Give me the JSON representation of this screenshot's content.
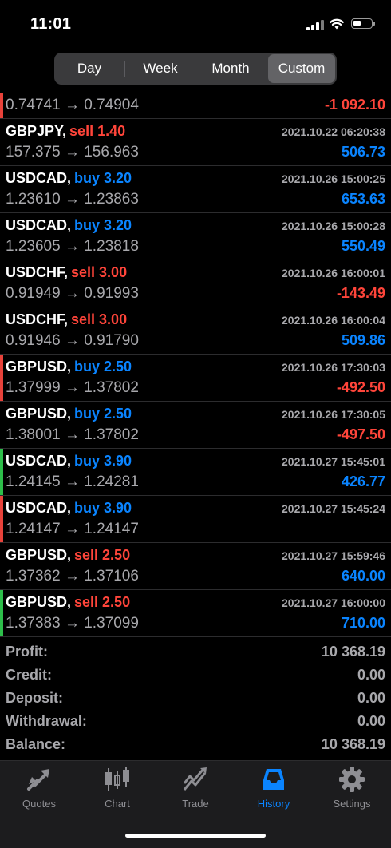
{
  "status": {
    "time": "11:01"
  },
  "periods": [
    "Day",
    "Week",
    "Month",
    "Custom"
  ],
  "active_period": "Custom",
  "first_row": {
    "prices": "0.74741 → 0.74904",
    "profit": "-1 092.10",
    "profit_sign": "neg",
    "marker": "red"
  },
  "trades": [
    {
      "symbol": "GBPJPY,",
      "side": "sell",
      "side_text": "sell 1.40",
      "time": "2021.10.22 06:20:38",
      "prices": "157.375 → 156.963",
      "profit": "506.73",
      "profit_sign": "pos",
      "marker": ""
    },
    {
      "symbol": "USDCAD,",
      "side": "buy",
      "side_text": "buy 3.20",
      "time": "2021.10.26 15:00:25",
      "prices": "1.23610 → 1.23863",
      "profit": "653.63",
      "profit_sign": "pos",
      "marker": ""
    },
    {
      "symbol": "USDCAD,",
      "side": "buy",
      "side_text": "buy 3.20",
      "time": "2021.10.26 15:00:28",
      "prices": "1.23605 → 1.23818",
      "profit": "550.49",
      "profit_sign": "pos",
      "marker": ""
    },
    {
      "symbol": "USDCHF,",
      "side": "sell",
      "side_text": "sell 3.00",
      "time": "2021.10.26 16:00:01",
      "prices": "0.91949 → 0.91993",
      "profit": "-143.49",
      "profit_sign": "neg",
      "marker": ""
    },
    {
      "symbol": "USDCHF,",
      "side": "sell",
      "side_text": "sell 3.00",
      "time": "2021.10.26 16:00:04",
      "prices": "0.91946 → 0.91790",
      "profit": "509.86",
      "profit_sign": "pos",
      "marker": ""
    },
    {
      "symbol": "GBPUSD,",
      "side": "buy",
      "side_text": "buy 2.50",
      "time": "2021.10.26 17:30:03",
      "prices": "1.37999 → 1.37802",
      "profit": "-492.50",
      "profit_sign": "neg",
      "marker": "red"
    },
    {
      "symbol": "GBPUSD,",
      "side": "buy",
      "side_text": "buy 2.50",
      "time": "2021.10.26 17:30:05",
      "prices": "1.38001 → 1.37802",
      "profit": "-497.50",
      "profit_sign": "neg",
      "marker": ""
    },
    {
      "symbol": "USDCAD,",
      "side": "buy",
      "side_text": "buy 3.90",
      "time": "2021.10.27 15:45:01",
      "prices": "1.24145 → 1.24281",
      "profit": "426.77",
      "profit_sign": "pos",
      "marker": "green"
    },
    {
      "symbol": "USDCAD,",
      "side": "buy",
      "side_text": "buy 3.90",
      "time": "2021.10.27 15:45:24",
      "prices": "1.24147 → 1.24147",
      "profit": "",
      "profit_sign": "pos",
      "marker": "red"
    },
    {
      "symbol": "GBPUSD,",
      "side": "sell",
      "side_text": "sell 2.50",
      "time": "2021.10.27 15:59:46",
      "prices": "1.37362 → 1.37106",
      "profit": "640.00",
      "profit_sign": "pos",
      "marker": ""
    },
    {
      "symbol": "GBPUSD,",
      "side": "sell",
      "side_text": "sell 2.50",
      "time": "2021.10.27 16:00:00",
      "prices": "1.37383 → 1.37099",
      "profit": "710.00",
      "profit_sign": "pos",
      "marker": "green"
    }
  ],
  "summary": [
    {
      "label": "Profit:",
      "value": "10 368.19"
    },
    {
      "label": "Credit:",
      "value": "0.00"
    },
    {
      "label": "Deposit:",
      "value": "0.00"
    },
    {
      "label": "Withdrawal:",
      "value": "0.00"
    },
    {
      "label": "Balance:",
      "value": "10 368.19"
    }
  ],
  "tabs": [
    {
      "label": "Quotes",
      "icon": "quotes-icon"
    },
    {
      "label": "Chart",
      "icon": "chart-icon"
    },
    {
      "label": "Trade",
      "icon": "trade-icon"
    },
    {
      "label": "History",
      "icon": "history-icon"
    },
    {
      "label": "Settings",
      "icon": "settings-icon"
    }
  ],
  "active_tab": "History",
  "colors": {
    "sell": "#ff453a",
    "buy": "#0a84ff",
    "loss": "#ff453a",
    "profit": "#0a84ff",
    "marker_red": "#e8423a",
    "marker_green": "#2dbe4a"
  }
}
